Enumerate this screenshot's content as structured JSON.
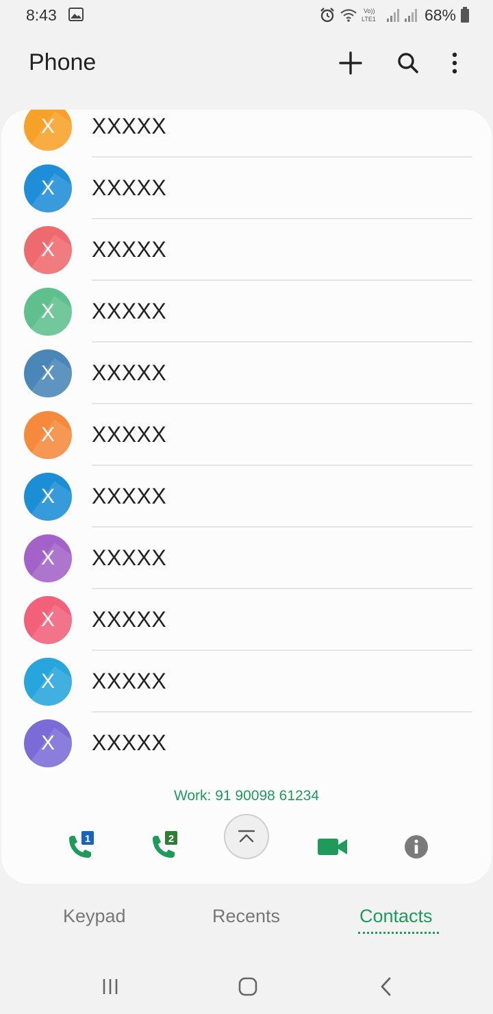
{
  "status_bar": {
    "time": "8:43",
    "battery": "68%",
    "icons": [
      "gallery-icon",
      "alarm-icon",
      "wifi-icon",
      "volte-icon",
      "signal-icon",
      "signal-icon",
      "battery-icon"
    ]
  },
  "app_bar": {
    "title": "Phone",
    "actions": [
      "add-icon",
      "search-icon",
      "more-icon"
    ]
  },
  "contacts": [
    {
      "initial": "X",
      "name": "XXXXX",
      "color": "#f7a128"
    },
    {
      "initial": "X",
      "name": "XXXXX",
      "color": "#1e8ed8"
    },
    {
      "initial": "X",
      "name": "XXXXX",
      "color": "#ef6a6e"
    },
    {
      "initial": "X",
      "name": "XXXXX",
      "color": "#5fc08e"
    },
    {
      "initial": "X",
      "name": "XXXXX",
      "color": "#4a86b8"
    },
    {
      "initial": "X",
      "name": "XXXXX",
      "color": "#f58a3c"
    },
    {
      "initial": "X",
      "name": "XXXXX",
      "color": "#1c8ed6"
    },
    {
      "initial": "X",
      "name": "XXXXX",
      "color": "#a262c8"
    },
    {
      "initial": "X",
      "name": "XXXXX",
      "color": "#f2607a"
    },
    {
      "initial": "X",
      "name": "XXXXX",
      "color": "#27a6dd"
    },
    {
      "initial": "X",
      "name": "XXXXX",
      "color": "#7b6bd6"
    }
  ],
  "expanded_contact": {
    "work_number": "Work: 91 90098 61234"
  },
  "actions": {
    "call_sim1_badge": "1",
    "call_sim2_badge": "2",
    "icons": [
      "call-sim1-icon",
      "call-sim2-icon",
      "scroll-top-icon",
      "video-call-icon",
      "info-icon"
    ]
  },
  "tabs": {
    "keypad": "Keypad",
    "recents": "Recents",
    "contacts": "Contacts",
    "active": "Contacts"
  },
  "colors": {
    "accent": "#1e9a5a",
    "sim1": "#1565c0",
    "sim2": "#2e7d32"
  },
  "nav_bar": [
    "recent-apps-icon",
    "home-icon",
    "back-icon"
  ]
}
